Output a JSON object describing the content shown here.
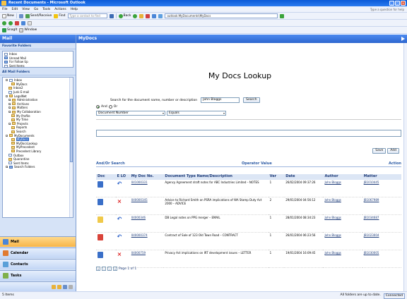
{
  "window": {
    "title": "Recent Documents - Microsoft Outlook"
  },
  "menu": [
    "File",
    "Edit",
    "View",
    "Go",
    "Tools",
    "Actions",
    "Help"
  ],
  "help_placeholder": "Type a question for help",
  "toolbar1": {
    "new": "New",
    "send_receive": "Send/Receive",
    "find": "Find",
    "type_contact": "Type a contact to find"
  },
  "toolbar2": {
    "back": "Back",
    "address": "outlook:MyDocuments\\MyDocs"
  },
  "toolbar3": {
    "snagit": "SnagIt",
    "window": "Window"
  },
  "left_pane": {
    "title": "Mail",
    "favorites_header": "Favorite Folders",
    "favorites": [
      "Inbox",
      "Unread Mail",
      "For Follow Up",
      "Sent Items"
    ],
    "all_header": "All Mail Folders",
    "folders": [
      "Inbox",
      "MyDocs",
      "Inbox2",
      "Junk E-mail",
      "LegalNet",
      "Administration",
      "Archives",
      "Matters",
      "My Collaboration",
      "My Profile",
      "My Time",
      "Projects",
      "Reports",
      "Search",
      "MyDocuments",
      "MyDocs",
      "MyDocsLookup",
      "MyPrecedent",
      "Precedent Library",
      "Outbox",
      "Quarantine",
      "Sent Items",
      "Search Folders"
    ],
    "nav": {
      "mail": "Mail",
      "calendar": "Calendar",
      "contacts": "Contacts",
      "tasks": "Tasks"
    }
  },
  "right_pane": {
    "title": "MyDocs",
    "heading": "My Docs Lookup",
    "search_label": "Search for the document name, number or description",
    "search_value": "John Bloggs",
    "search_button": "Search",
    "and_label": "And",
    "or_label": "Or",
    "field_select": "Document Number",
    "operator_select": "Equals",
    "save_button": "Save",
    "add_button": "Add",
    "ops": {
      "andor": "And/Or Search",
      "operator": "Operator Value",
      "action": "Action"
    },
    "columns": [
      "Doc",
      "E LO",
      "My Doc No.",
      "Document Type Name/Description",
      "Ver",
      "Date",
      "Author",
      "Matter"
    ],
    "rows": [
      {
        "no": "041000331",
        "desc": "Agency Agreement draft notes for ABC Industries Limited – NOTES",
        "ver": "1",
        "date": "26/02/2004 09:37:26",
        "author": "John Bloggs",
        "matter": "JB1010445"
      },
      {
        "no": "040000345",
        "desc": "Advice to Richard Smith on PSRA implications of WA Stamp Duty Act 2000 – ADVICE",
        "ver": "2",
        "date": "29/01/2004 04:56:12",
        "author": "John Bloggs",
        "matter": "JB1067989"
      },
      {
        "no": "04000346",
        "desc": "DB Legal notes on PPG merger – EMAIL",
        "ver": "1",
        "date": "28/01/2004 08:34:23",
        "author": "John Bloggs",
        "matter": "JB1034687"
      },
      {
        "no": "040000374",
        "desc": "Contract of Sale of 123 Old Town Road – CONTRACT",
        "ver": "1",
        "date": "26/01/2004 06:23:56",
        "author": "John Bloggs",
        "matter": "JB1023004"
      },
      {
        "no": "04000759",
        "desc": "Privacy Act implications on IRT development issues – LETTER",
        "ver": "1",
        "date": "19/01/2004 16:09:45",
        "author": "John Bloggs",
        "matter": "JB1030005"
      }
    ],
    "pager": "Page 1 of 1"
  },
  "status": {
    "left": "5 Items",
    "right": "All folders are up to date.",
    "connected": "Connected"
  }
}
